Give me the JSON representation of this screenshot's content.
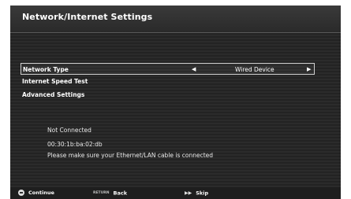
{
  "header": {
    "title": "Network/Internet Settings"
  },
  "menu": {
    "items": [
      {
        "label": "Network Type",
        "value": "Wired Device",
        "left_arrow": "◀",
        "right_arrow": "▶"
      },
      {
        "label": "Internet Speed Test"
      },
      {
        "label": "Advanced Settings"
      }
    ]
  },
  "status": {
    "connection": "Not Connected",
    "mac_address": "00:30:1b:ba:02:db",
    "message": "Please make sure your Ethernet/LAN cable is connected"
  },
  "footer": {
    "continue_label": "Continue",
    "back_key_label": "RETURN",
    "back_label": "Back",
    "skip_key_label": "▶▶",
    "skip_label": "Skip"
  }
}
